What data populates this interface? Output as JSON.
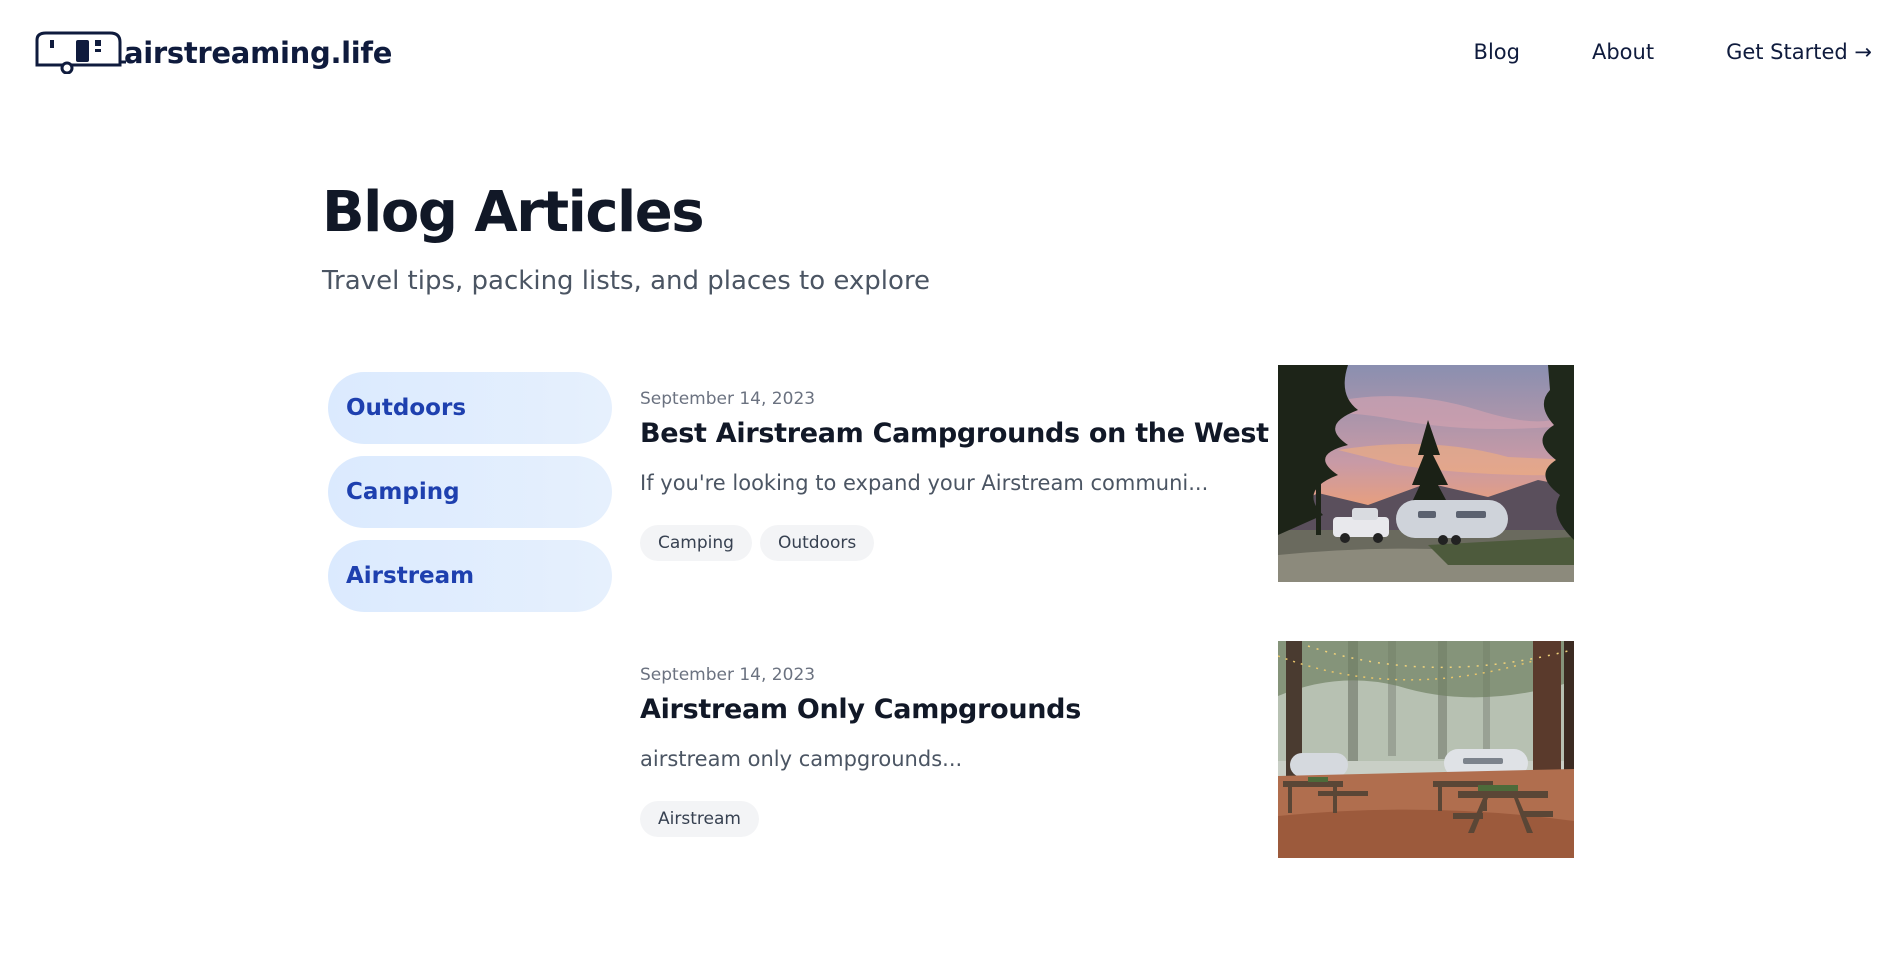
{
  "site": {
    "name": "airstreaming.life",
    "logo_icon": "airstream-trailer-icon"
  },
  "nav": {
    "blog": "Blog",
    "about": "About",
    "get_started": "Get Started →"
  },
  "page": {
    "title": "Blog Articles",
    "subtitle": "Travel tips, packing lists, and places to explore"
  },
  "categories": [
    "Outdoors",
    "Camping",
    "Airstream"
  ],
  "articles": [
    {
      "date": "September 14, 2023",
      "title": "Best Airstream Campgrounds on the West Coast",
      "excerpt": "If you're looking to expand your Airstream communi...",
      "tags": [
        "Camping",
        "Outdoors"
      ],
      "image": "sunset campsite with pickup truck and airstream trailer among pine trees"
    },
    {
      "date": "September 14, 2023",
      "title": "Airstream Only Campgrounds",
      "excerpt": "airstream only campgrounds...",
      "tags": [
        "Airstream"
      ],
      "image": "redwood forest campground with picnic tables and airstream trailers"
    }
  ],
  "colors": {
    "brand_navy": "#0f1b3d",
    "category_bg": "#dbeafe",
    "category_text": "#1e40af",
    "tag_bg": "#f3f4f6"
  }
}
